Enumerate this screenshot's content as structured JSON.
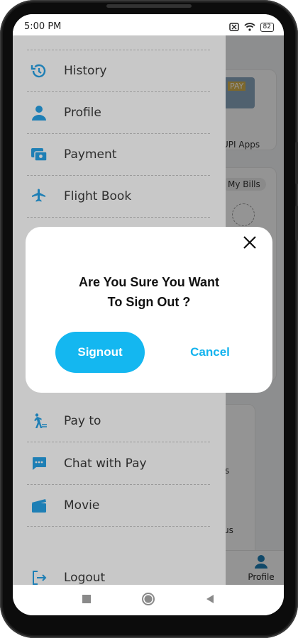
{
  "status_bar": {
    "time": "5:00 PM",
    "battery": "82"
  },
  "background": {
    "upi_label": "UPI Apps",
    "bills_chip": "My Bills",
    "partial_s": "s",
    "partial_us": "us",
    "nav_profile": "Profile",
    "pay_badge": "PAY"
  },
  "drawer": {
    "items": [
      {
        "label": "History",
        "icon": "history-icon"
      },
      {
        "label": "Profile",
        "icon": "user-icon"
      },
      {
        "label": "Payment",
        "icon": "payment-card-icon"
      },
      {
        "label": "Flight Book",
        "icon": "airplane-icon"
      },
      {
        "label": "Pay to",
        "icon": "walking-person-icon"
      },
      {
        "label": "Chat with Pay",
        "icon": "chat-icon"
      },
      {
        "label": "Movie",
        "icon": "clapperboard-icon"
      }
    ],
    "logout": "Logout"
  },
  "dialog": {
    "line1": "Are You Sure You Want",
    "line2": "To Sign Out ?",
    "confirm": "Signout",
    "cancel": "Cancel"
  },
  "colors": {
    "accent": "#14b7f0",
    "icon": "#1e7fb5"
  }
}
